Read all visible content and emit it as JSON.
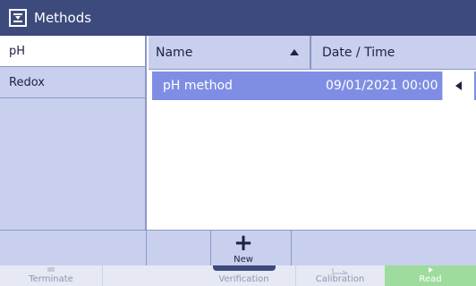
{
  "title": "Methods",
  "sidebar": {
    "items": [
      {
        "label": "pH",
        "active": true
      },
      {
        "label": "Redox",
        "active": false
      }
    ]
  },
  "table": {
    "columns": {
      "name": "Name",
      "date": "Date / Time"
    },
    "rows": [
      {
        "name": "pH method",
        "date": "09/01/2021 00:00"
      }
    ]
  },
  "actions": {
    "new_label": "New"
  },
  "bottom": {
    "terminate": "Terminate",
    "verification": "Verification",
    "calibration": "Calibration",
    "read": "Read"
  },
  "colors": {
    "titlebar": "#3d4a7c",
    "panel": "#c8d0ee",
    "row_selected": "#7f8ee4",
    "read_button": "#9edc9e"
  }
}
